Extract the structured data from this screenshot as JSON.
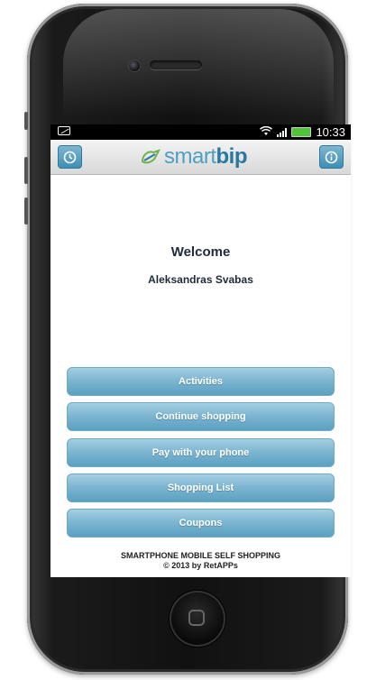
{
  "status_bar": {
    "time": "10:33",
    "icons": [
      "sd-card-icon",
      "wifi-icon",
      "signal-icon",
      "battery-icon"
    ]
  },
  "header": {
    "logo_light": "smart",
    "logo_bold": "bip",
    "left_icon": "clock-icon",
    "right_icon": "info-icon"
  },
  "main": {
    "welcome": "Welcome",
    "user_name": "Aleksandras Svabas"
  },
  "menu": {
    "items": [
      {
        "label": "Activities"
      },
      {
        "label": "Continue shopping"
      },
      {
        "label": "Pay with your phone"
      },
      {
        "label": "Shopping List"
      },
      {
        "label": "Coupons"
      }
    ]
  },
  "footer": {
    "line1": "SMARTPHONE MOBILE SELF SHOPPING",
    "line2": "© 2013 by RetAPPs"
  },
  "colors": {
    "accent": "#5ba0c2",
    "logo_dark": "#2a77a0",
    "battery": "#4fc33a"
  }
}
